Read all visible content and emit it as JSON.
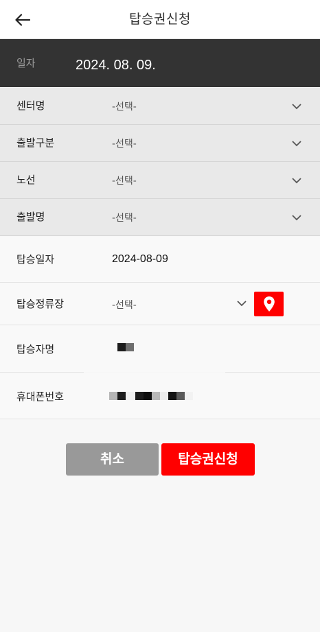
{
  "header": {
    "title": "탑승권신청",
    "back_icon": "arrow-left-icon"
  },
  "date_bar": {
    "label": "일자",
    "value": "2024. 08. 09."
  },
  "filters": [
    {
      "label": "센터명",
      "value": "-선택-"
    },
    {
      "label": "출발구분",
      "value": "-선택-"
    },
    {
      "label": "노선",
      "value": "-선택-"
    },
    {
      "label": "출발명",
      "value": "-선택-"
    }
  ],
  "form": {
    "board_date_label": "탑승일자",
    "board_date_value": "2024-08-09",
    "stop_label": "탑승정류장",
    "stop_value": "-선택-",
    "stop_map_icon": "map-pin-icon",
    "name_label": "탑승자명",
    "phone_label": "휴대폰번호"
  },
  "buttons": {
    "cancel": "취소",
    "apply": "탑승권신청"
  },
  "colors": {
    "accent": "#ff0000",
    "dark_bar": "#333333",
    "cancel_gray": "#999999"
  }
}
